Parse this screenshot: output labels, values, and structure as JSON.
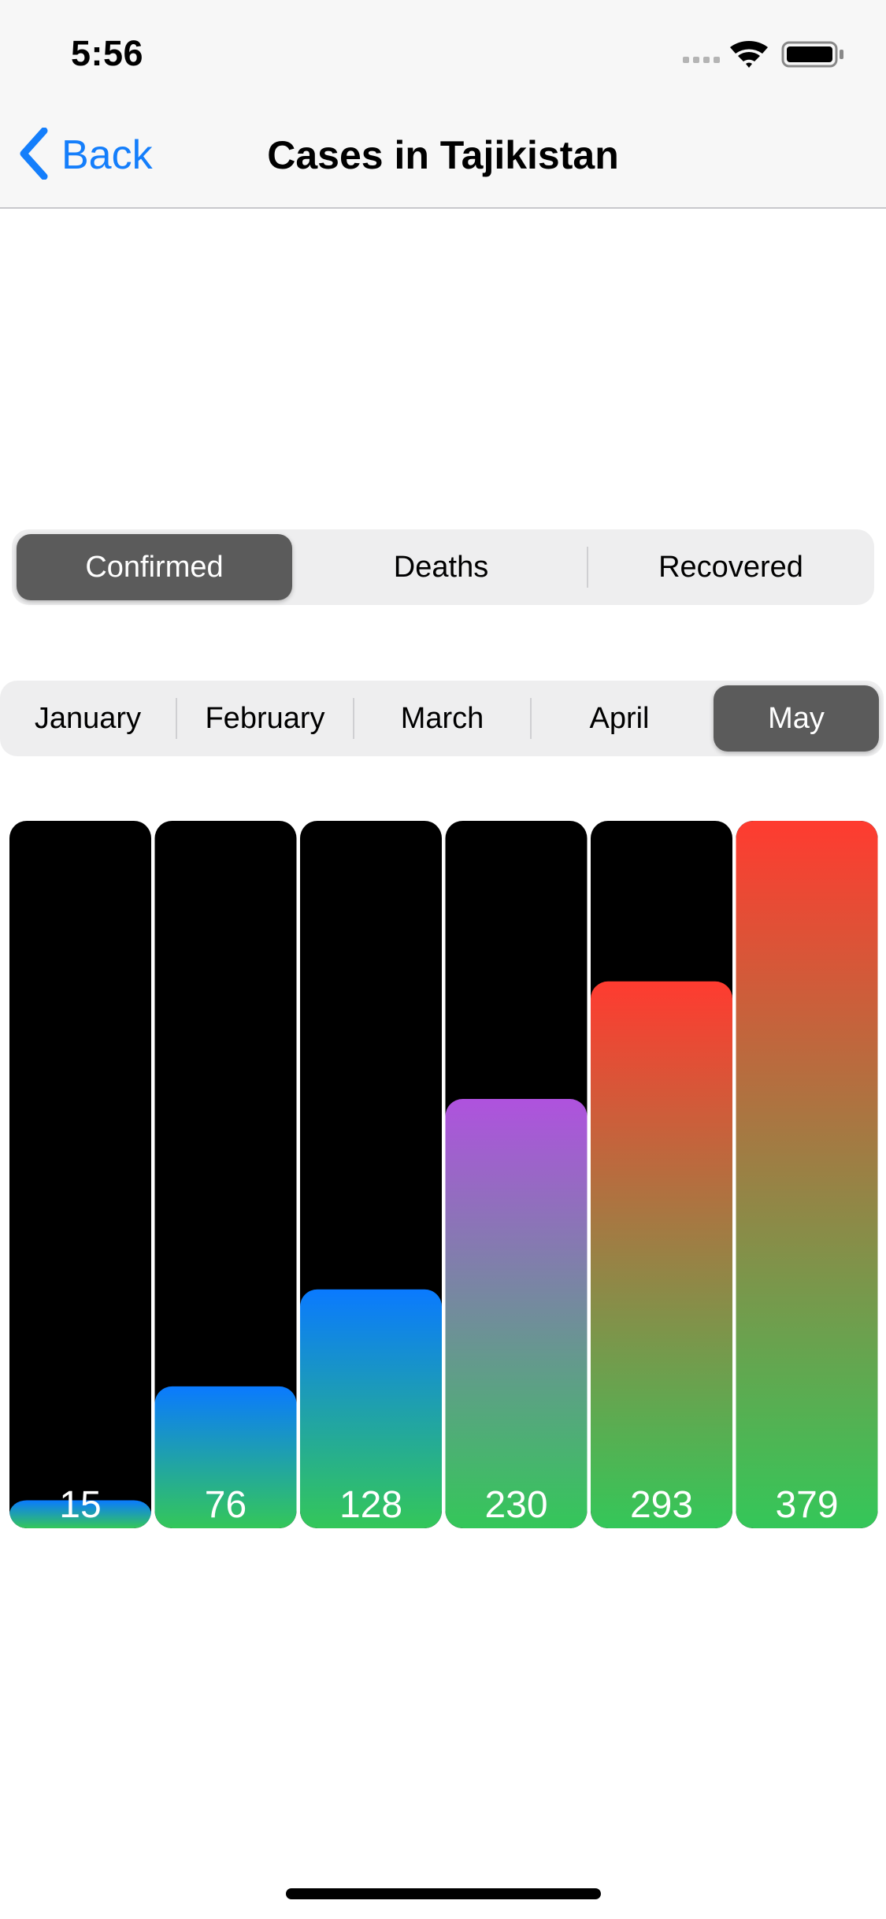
{
  "status_bar": {
    "time": "5:56"
  },
  "nav": {
    "back_label": "Back",
    "title": "Cases in Tajikistan"
  },
  "metric_tabs": {
    "items": [
      "Confirmed",
      "Deaths",
      "Recovered"
    ],
    "selected": 0
  },
  "month_tabs": {
    "items": [
      "January",
      "February",
      "March",
      "April",
      "May"
    ],
    "selected": 4
  },
  "colors": {
    "accent": "#147efb",
    "segment_selected": "#5b5b5b",
    "bar_background": "#000000",
    "gradient_blue": "#0a7aff",
    "gradient_purple": "#af52de",
    "gradient_red": "#ff3b30",
    "gradient_green": "#34c759"
  },
  "chart_data": {
    "type": "bar",
    "values": [
      15,
      76,
      128,
      230,
      293,
      379
    ],
    "labels": [
      "15",
      "76",
      "128",
      "230",
      "293",
      "379"
    ],
    "ylim": [
      0,
      379
    ]
  }
}
